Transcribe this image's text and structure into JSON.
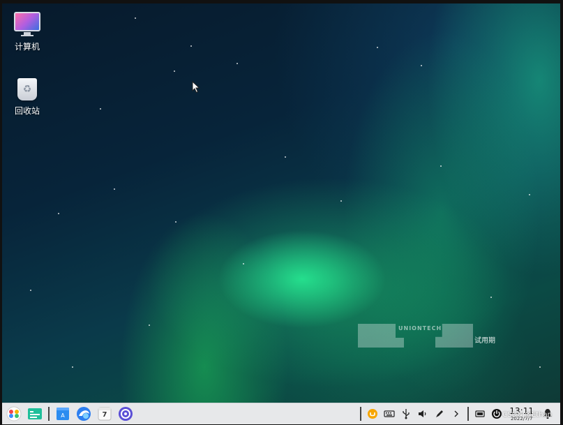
{
  "desktop": {
    "icons": [
      {
        "label": "计算机",
        "icon": "computer-icon"
      },
      {
        "label": "回收站",
        "icon": "trash-icon"
      }
    ],
    "watermark": {
      "brand": "UNIONTECH",
      "trial": "试用期"
    }
  },
  "taskbar": {
    "apps": [
      {
        "name": "launcher",
        "icon": "launcher-icon"
      },
      {
        "name": "file-manager",
        "icon": "file-manager-icon"
      },
      {
        "name": "app-store",
        "icon": "app-store-icon"
      },
      {
        "name": "browser",
        "icon": "browser-icon"
      },
      {
        "name": "calendar",
        "icon": "calendar-icon",
        "text": "7"
      },
      {
        "name": "control-center",
        "icon": "settings-icon"
      }
    ],
    "tray": {
      "icons": [
        "input-method-icon",
        "keyboard-icon",
        "usb-icon",
        "volume-icon",
        "pen-icon",
        "expand-icon",
        "display-icon",
        "power-icon"
      ],
      "time": "13:11",
      "date": "2022/7/7",
      "overlay": "CSDN @Ethan"
    }
  },
  "colors": {
    "taskbar_bg": "#e7e8ea",
    "aurora_green": "#28f096"
  }
}
